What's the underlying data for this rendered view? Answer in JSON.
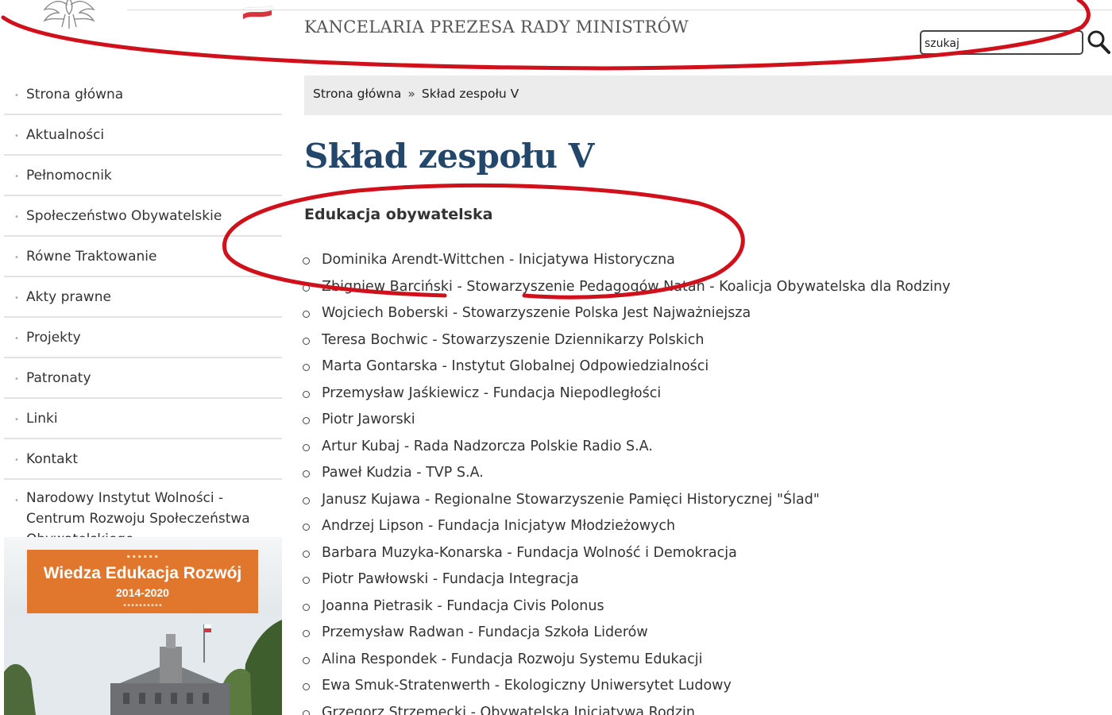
{
  "header": {
    "org_name": "KANCELARIA PREZESA RADY MINISTRÓW",
    "search": {
      "value": "szukaj",
      "placeholder": "szukaj"
    }
  },
  "sidebar": {
    "items": [
      {
        "label": "Strona główna"
      },
      {
        "label": "Aktualności"
      },
      {
        "label": "Pełnomocnik"
      },
      {
        "label": "Społeczeństwo Obywatelskie"
      },
      {
        "label": "Równe Traktowanie"
      },
      {
        "label": "Akty prawne"
      },
      {
        "label": "Projekty"
      },
      {
        "label": "Patronaty"
      },
      {
        "label": "Linki"
      },
      {
        "label": "Kontakt"
      },
      {
        "label": "Narodowy Instytut Wolności - Centrum Rozwoju Społeczeństwa Obywatelskiego"
      }
    ],
    "promo": {
      "title": "Wiedza Edukacja Rozwój",
      "years": "2014-2020"
    }
  },
  "breadcrumb": {
    "home": "Strona główna",
    "separator": "»",
    "current": "Skład zespołu V"
  },
  "page": {
    "title": "Skład zespołu V",
    "section_title": "Edukacja obywatelska",
    "members": [
      "Dominika Arendt-Wittchen - Inicjatywa Historyczna",
      "Zbigniew Barciński - Stowarzyszenie Pedagogów Natan - Koalicja Obywatelska dla Rodziny",
      "Wojciech Boberski - Stowarzyszenie Polska Jest Najważniejsza",
      "Teresa Bochwic - Stowarzyszenie Dziennikarzy Polskich",
      "Marta Gontarska - Instytut Globalnej Odpowiedzialności",
      "Przemysław Jaśkiewicz - Fundacja Niepodległości",
      "Piotr Jaworski",
      "Artur Kubaj - Rada Nadzorcza Polskie Radio S.A.",
      "Paweł Kudzia - TVP S.A.",
      "Janusz  Kujawa - Regionalne Stowarzyszenie Pamięci Historycznej \"Ślad\"",
      "Andrzej Lipson - Fundacja Inicjatyw Młodzieżowych",
      "Barbara Muzyka-Konarska - Fundacja Wolność i Demokracja",
      "Piotr Pawłowski - Fundacja Integracja",
      "Joanna Pietrasik - Fundacja Civis Polonus",
      "Przemysław Radwan - Fundacja Szkoła Liderów",
      "Alina Respondek - Fundacja Rozwoju Systemu Edukacji",
      "Ewa Smuk-Stratenwerth - Ekologiczny Uniwersytet Ludowy",
      "Grzegorz Strzemecki - Obywatelska Inicjatywa Rodzin"
    ]
  },
  "colors": {
    "title_blue": "#23466b",
    "annotation_red": "#d0101b",
    "promo_orange": "#e1762d",
    "breadcrumb_bg": "#ececec"
  },
  "icons": {
    "emblem": "polish-eagle-icon",
    "flag": "polish-flag-icon",
    "search": "search-icon",
    "list_bullet": "ring-bullet-icon"
  }
}
